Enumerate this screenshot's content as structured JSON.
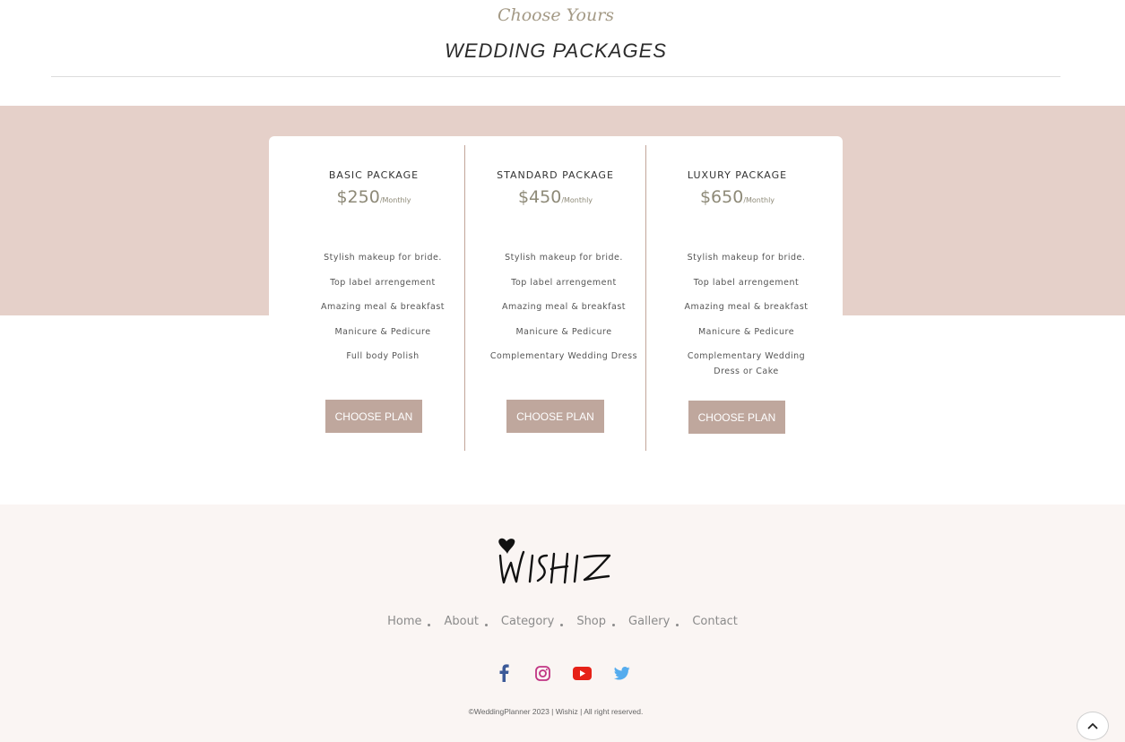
{
  "header": {
    "kicker": "Choose Yours",
    "title": "WEDDING PACKAGES"
  },
  "plans": [
    {
      "name": "BASIC PACKAGE",
      "price": "$250",
      "period": "/Monthly",
      "features": [
        "Stylish makeup for bride.",
        "Top label arrengement",
        "Amazing meal & breakfast",
        "Manicure & Pedicure",
        "Full body Polish"
      ],
      "button": "CHOOSE PLAN"
    },
    {
      "name": "STANDARD PACKAGE",
      "price": "$450",
      "period": "/Monthly",
      "features": [
        "Stylish makeup for bride.",
        "Top label arrengement",
        "Amazing meal & breakfast",
        "Manicure & Pedicure",
        "Complementary Wedding Dress"
      ],
      "button": "CHOOSE PLAN"
    },
    {
      "name": "LUXURY PACKAGE",
      "price": "$650",
      "period": "/Monthly",
      "features": [
        "Stylish makeup for bride.",
        "Top label arrengement",
        "Amazing meal & breakfast",
        "Manicure & Pedicure",
        "Complementary Wedding Dress or Cake"
      ],
      "button": "CHOOSE PLAN"
    }
  ],
  "footer": {
    "logo": "WISHIZ",
    "nav": [
      "Home",
      "About",
      "Category",
      "Shop",
      "Gallery",
      "Contact"
    ],
    "social": [
      {
        "icon": "facebook-icon",
        "color": "#3b5998"
      },
      {
        "icon": "instagram-icon",
        "color": "#c13584"
      },
      {
        "icon": "youtube-icon",
        "color": "#e62117"
      },
      {
        "icon": "twitter-icon",
        "color": "#55acee"
      }
    ],
    "copyright": "©WeddingPlanner 2023 | Wishiz | All right reserved."
  },
  "colors": {
    "band": "#e5d0c9",
    "button": "#bfa79d",
    "price": "#8e8a78",
    "footer_bg": "#faf5f3"
  }
}
